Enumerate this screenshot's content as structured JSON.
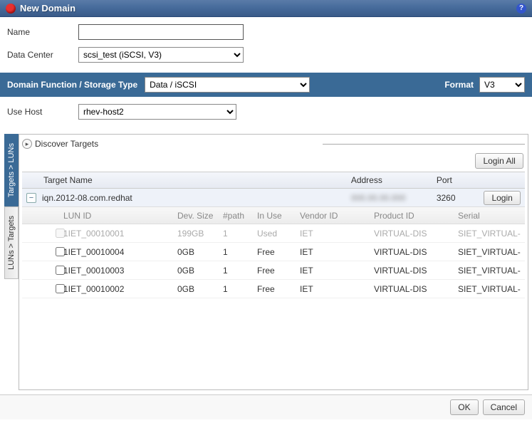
{
  "title": "New Domain",
  "labels": {
    "name": "Name",
    "dataCenter": "Data Center",
    "domainFunction": "Domain Function / Storage Type",
    "format": "Format",
    "useHost": "Use Host",
    "discoverTargets": "Discover Targets",
    "loginAll": "Login All",
    "login": "Login",
    "ok": "OK",
    "cancel": "Cancel"
  },
  "fields": {
    "name": "",
    "dataCenter": "scsi_test (iSCSI, V3)",
    "storageType": "Data / iSCSI",
    "format": "V3",
    "useHost": "rhev-host2"
  },
  "vtabs": {
    "tab1": "Targets > LUNs",
    "tab2": "LUNs > Targets"
  },
  "targetHeaders": {
    "name": "Target Name",
    "address": "Address",
    "port": "Port"
  },
  "target": {
    "name": "iqn.2012-08.com.redhat",
    "address": "000.00.00.000",
    "port": "3260"
  },
  "lunHeaders": {
    "lunId": "LUN ID",
    "devSize": "Dev. Size",
    "path": "#path",
    "inUse": "In Use",
    "vendor": "Vendor ID",
    "product": "Product ID",
    "serial": "Serial"
  },
  "luns": [
    {
      "id": "1IET_00010001",
      "size": "199GB",
      "path": "1",
      "inUse": "Used",
      "vendor": "IET",
      "product": "VIRTUAL-DIS",
      "serial": "SIET_VIRTUAL-",
      "used": true
    },
    {
      "id": "1IET_00010004",
      "size": "0GB",
      "path": "1",
      "inUse": "Free",
      "vendor": "IET",
      "product": "VIRTUAL-DIS",
      "serial": "SIET_VIRTUAL-",
      "used": false
    },
    {
      "id": "1IET_00010003",
      "size": "0GB",
      "path": "1",
      "inUse": "Free",
      "vendor": "IET",
      "product": "VIRTUAL-DIS",
      "serial": "SIET_VIRTUAL-",
      "used": false
    },
    {
      "id": "1IET_00010002",
      "size": "0GB",
      "path": "1",
      "inUse": "Free",
      "vendor": "IET",
      "product": "VIRTUAL-DIS",
      "serial": "SIET_VIRTUAL-",
      "used": false
    }
  ]
}
